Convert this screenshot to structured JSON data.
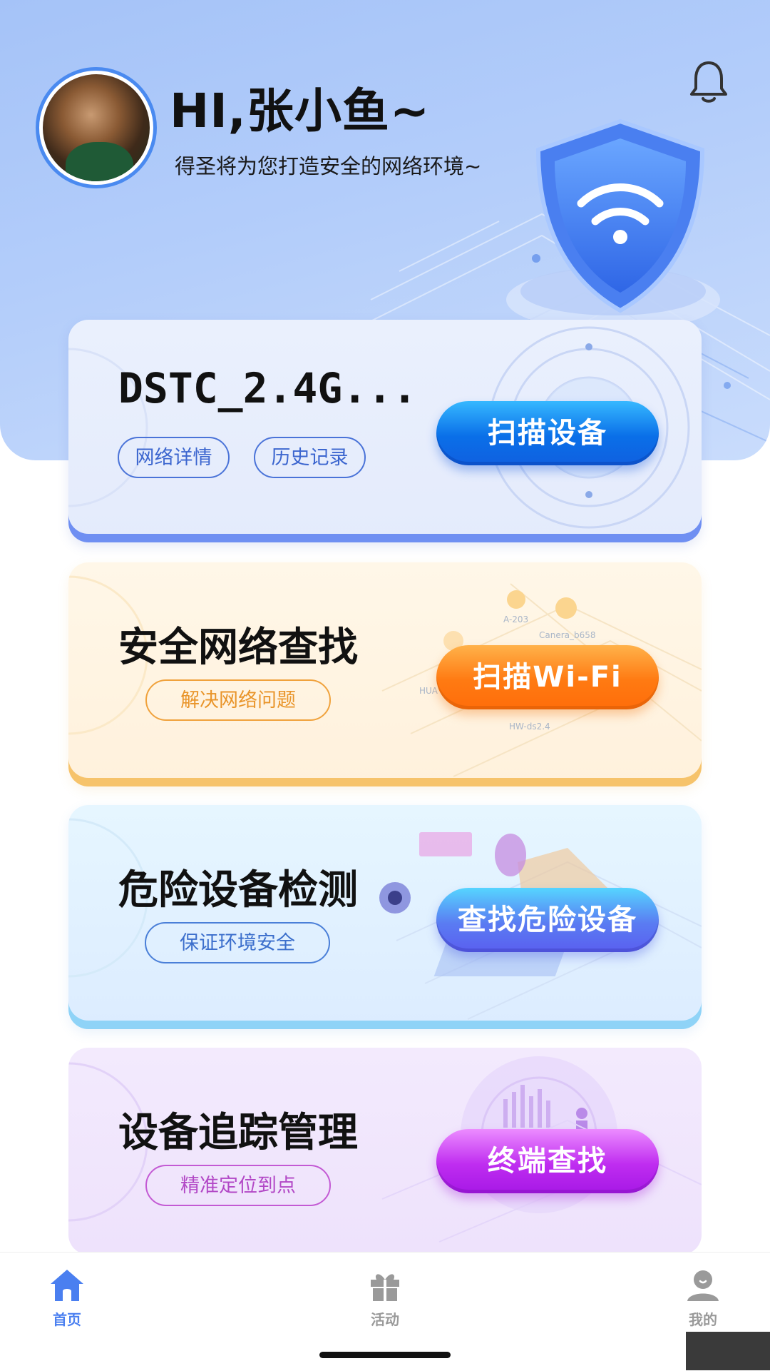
{
  "header": {
    "greeting": "HI,张小鱼~",
    "subtitle": "得圣将为您打造安全的网络环境~",
    "notification_icon": "bell-icon",
    "avatar_icon": "avatar"
  },
  "cards": [
    {
      "title": "DSTC_2.4G...",
      "pills": [
        "网络详情",
        "历史记录"
      ],
      "action": "扫描设备",
      "accent": "#0a6fe8"
    },
    {
      "title": "安全网络查找",
      "pills": [
        "解决网络问题"
      ],
      "action": "扫描Wi-Fi",
      "accent": "#ff7a12",
      "decor_labels": [
        "A-203",
        "Canera_b658",
        "HUA",
        "HW-ds2.4"
      ]
    },
    {
      "title": "危险设备检测",
      "pills": [
        "保证环境安全"
      ],
      "action": "查找危险设备",
      "accent": "#5a6ff0"
    },
    {
      "title": "设备追踪管理",
      "pills": [
        "精准定位到点"
      ],
      "action": "终端查找",
      "accent": "#bf2df0"
    }
  ],
  "tabbar": {
    "items": [
      {
        "label": "首页",
        "icon": "home-icon",
        "active": true
      },
      {
        "label": "活动",
        "icon": "gift-icon",
        "active": false
      },
      {
        "label": "我的",
        "icon": "user-icon",
        "active": false
      }
    ],
    "active_color": "#4a7ff0",
    "inactive_color": "#9a9a9a"
  }
}
